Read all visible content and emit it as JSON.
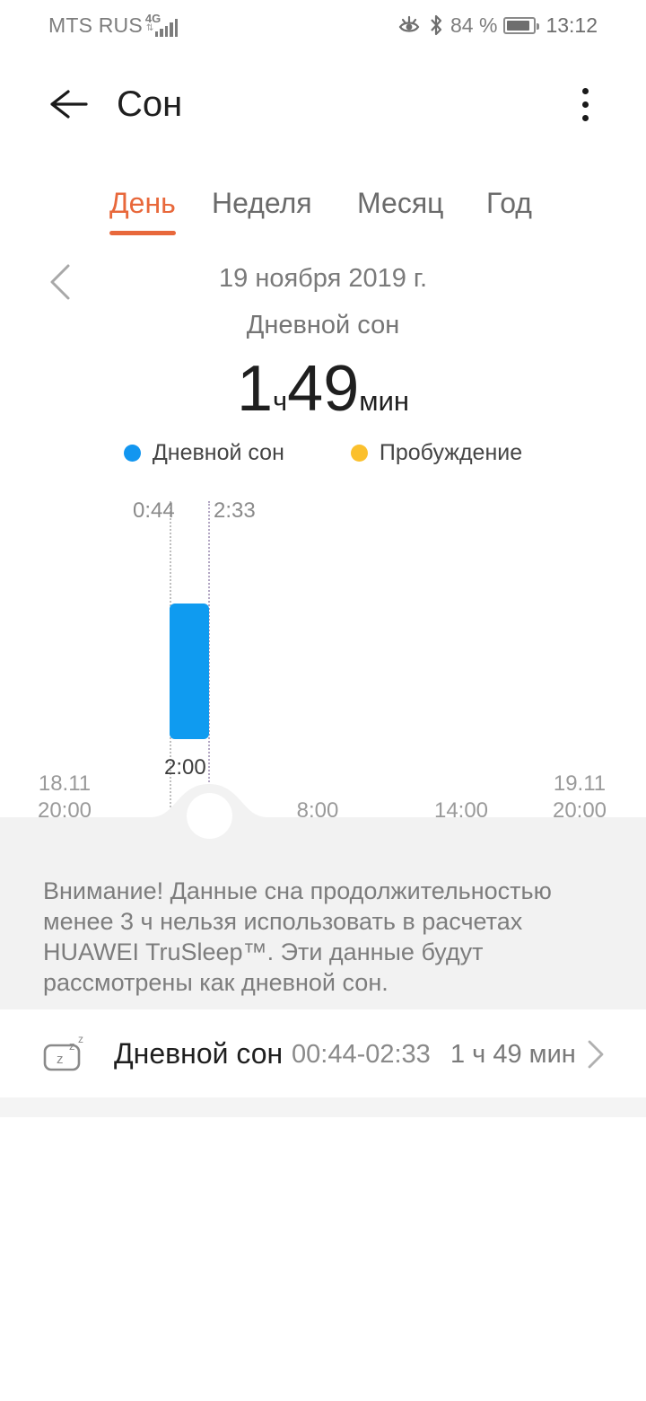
{
  "statusbar": {
    "carrier": "MTS RUS",
    "network": "4G",
    "battery_pct": "84 %",
    "time": "13:12",
    "icons": [
      "eye-comfort-icon",
      "bluetooth-icon",
      "signal-icon",
      "battery-icon"
    ]
  },
  "appbar": {
    "title": "Сон",
    "back": "back-arrow-icon",
    "menu": "overflow-menu-icon"
  },
  "tabs": [
    {
      "label": "День",
      "active": true
    },
    {
      "label": "Неделя",
      "active": false
    },
    {
      "label": "Месяц",
      "active": false
    },
    {
      "label": "Год",
      "active": false
    }
  ],
  "datenav": {
    "prev_icon": "chevron-left-icon",
    "date": "19 ноября 2019 г.",
    "sleep_type": "Дневной сон"
  },
  "summary": {
    "hours_value": "1",
    "hours_unit": "ч",
    "minutes_value": "49",
    "minutes_unit": "мин"
  },
  "legend": [
    {
      "label": "Дневной сон",
      "color": "#1296f0"
    },
    {
      "label": "Пробуждение",
      "color": "#fbc02d"
    }
  ],
  "chart_data": {
    "type": "bar",
    "title": "",
    "xlabel": "",
    "ylabel": "",
    "orientation": "vertical-time-range",
    "x_axis_ticks": [
      {
        "label_line1": "18.11",
        "label_line2": "20:00",
        "pos_pct": 0
      },
      {
        "label_line1": "",
        "label_line2": "2:00",
        "pos_pct": 25
      },
      {
        "label_line1": "",
        "label_line2": "8:00",
        "pos_pct": 50
      },
      {
        "label_line1": "",
        "label_line2": "14:00",
        "pos_pct": 75
      },
      {
        "label_line1": "19.11",
        "label_line2": "20:00",
        "pos_pct": 100
      }
    ],
    "axis_range": [
      "18.11 20:00",
      "19.11 20:00"
    ],
    "grid": true,
    "legend_position": "top",
    "marker_labels": {
      "start": "0:44",
      "end": "2:33",
      "tick": "2:00"
    },
    "series": [
      {
        "name": "Дневной сон",
        "color": "#0f9bf0",
        "segments": [
          {
            "start": "00:44",
            "end": "02:33",
            "duration_min": 109,
            "label": "Дневной сон"
          }
        ]
      },
      {
        "name": "Пробуждение",
        "color": "#fbc02d",
        "segments": []
      }
    ]
  },
  "warning": {
    "text": "Внимание! Данные сна продолжительностью менее 3 ч нельзя использовать в расчетах HUAWEI TruSleep™. Эти данные будут рассмотрены как дневной сон."
  },
  "detail": {
    "icon": "sleep-zzz-icon",
    "name": "Дневной сон",
    "time_range": "00:44-02:33",
    "duration": "1 ч 49 мин",
    "chevron": "chevron-right-icon"
  }
}
